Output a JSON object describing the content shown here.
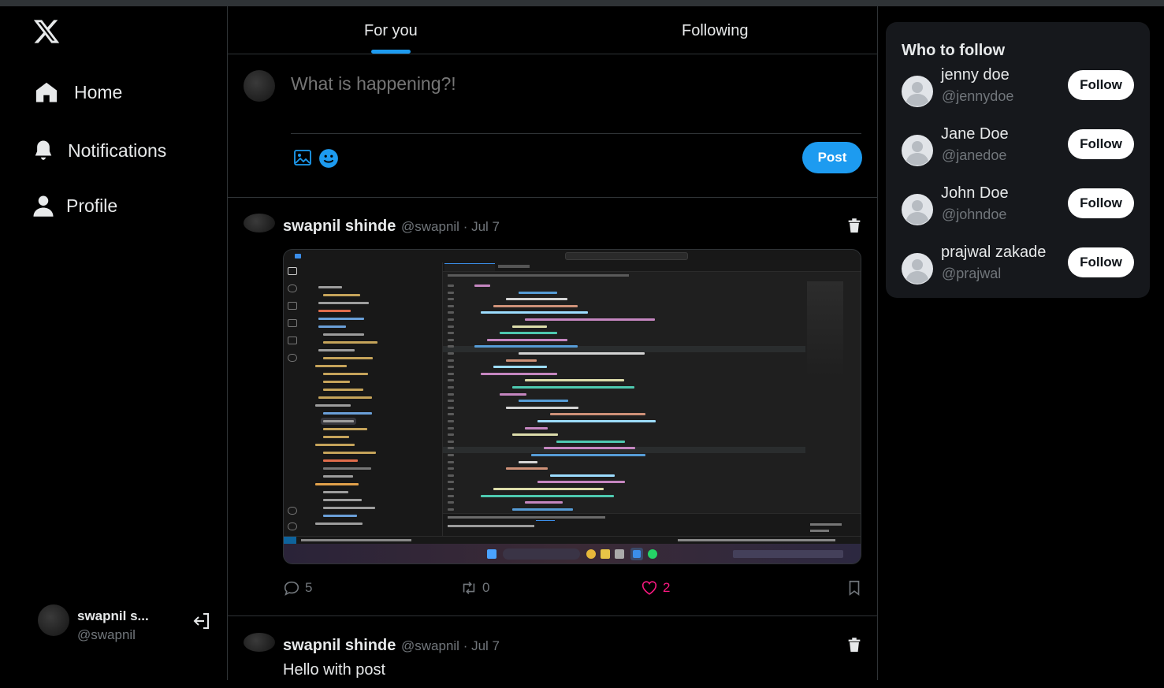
{
  "nav": {
    "logo": "x-logo",
    "items": [
      {
        "label": "Home",
        "icon": "home-icon"
      },
      {
        "label": "Notifications",
        "icon": "bell-icon"
      },
      {
        "label": "Profile",
        "icon": "person-icon"
      }
    ]
  },
  "account": {
    "name": "swapnil s...",
    "handle": "@swapnil"
  },
  "tabs": [
    {
      "label": "For you",
      "active": true
    },
    {
      "label": "Following",
      "active": false
    }
  ],
  "composer": {
    "placeholder": "What is happening?!",
    "post_label": "Post"
  },
  "tweets": [
    {
      "author": "swapnil shinde",
      "handle": "@swapnil",
      "date": "Jul 7",
      "has_media": true,
      "replies": "5",
      "retweets": "0",
      "likes": "2"
    },
    {
      "author": "swapnil shinde",
      "handle": "@swapnil",
      "date": "Jul 7",
      "text": "Hello with post"
    }
  ],
  "who_to_follow": {
    "title": "Who to follow",
    "follow_label": "Follow",
    "users": [
      {
        "name": "jenny doe",
        "handle": "@jennydoe"
      },
      {
        "name": "Jane Doe",
        "handle": "@janedoe"
      },
      {
        "name": "John Doe",
        "handle": "@johndoe"
      },
      {
        "name": "prajwal zakade",
        "handle": "@prajwal"
      }
    ]
  },
  "colors": {
    "accent": "#1d9bf0",
    "like": "#f91880",
    "muted": "#71767b",
    "border": "#2f3336",
    "card": "#16181c"
  }
}
